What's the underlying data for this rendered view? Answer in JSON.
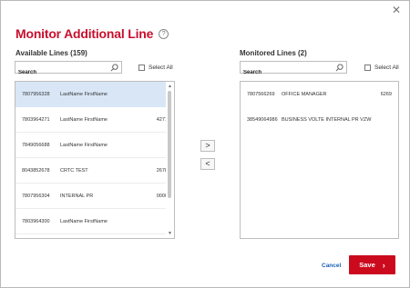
{
  "dialog": {
    "title": "Monitor Additional Line",
    "help_icon": "question-icon",
    "close_glyph": "✕"
  },
  "available": {
    "label": "Available Lines (159)",
    "search_placeholder": "Search",
    "select_all": "Select All",
    "rows": [
      {
        "number": "7807956328",
        "name": "LastName FirstName",
        "ext": "",
        "selected": true
      },
      {
        "number": "7803964271",
        "name": "LastName FirstName",
        "ext": "4271",
        "selected": false
      },
      {
        "number": "7849056688",
        "name": "LastName FirstName",
        "ext": "",
        "selected": false
      },
      {
        "number": "8043852678",
        "name": "CRTC TEST",
        "ext": "2678",
        "selected": false
      },
      {
        "number": "7807956304",
        "name": "INTERNAL PR",
        "ext": "0000",
        "selected": false
      },
      {
        "number": "7803964300",
        "name": "LastName FirstName",
        "ext": "",
        "selected": false
      }
    ]
  },
  "monitored": {
    "label": "Monitored Lines (2)",
    "search_placeholder": "Search",
    "select_all": "Select All",
    "rows": [
      {
        "number": "7807566269",
        "name": "OFFICE MANAGER",
        "ext": "6269"
      },
      {
        "number": "38549064986",
        "name": "BUSINESS VOLTE INTERNAL PR VZW",
        "ext": ""
      }
    ]
  },
  "actions": {
    "move_right": ">",
    "move_left": "<",
    "cancel": "Cancel",
    "save": "Save",
    "save_chevron": "›"
  },
  "colors": {
    "accent_red": "#cc0a1e",
    "title_red": "#c8102e",
    "link_blue": "#1d5fb5",
    "selected_row": "#d9e6f6"
  }
}
